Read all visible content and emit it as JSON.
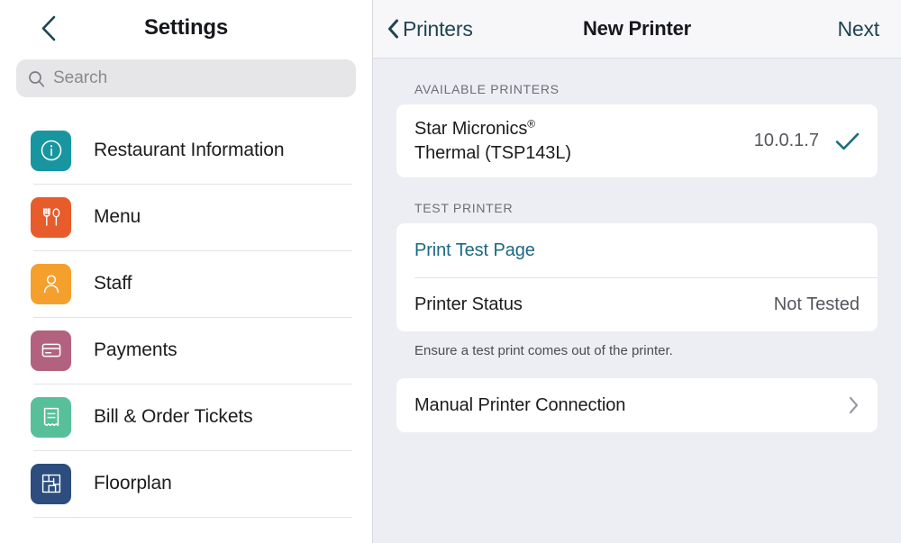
{
  "sidebar": {
    "back_icon": "chevron-left-icon",
    "title": "Settings",
    "search": {
      "icon": "search-icon",
      "value": "",
      "placeholder": "Search"
    },
    "items": [
      {
        "label": "Restaurant Information",
        "icon": "info-circle-icon",
        "color": "#1896a0"
      },
      {
        "label": "Menu",
        "icon": "fork-spoon-icon",
        "color": "#e85c2b"
      },
      {
        "label": "Staff",
        "icon": "person-icon",
        "color": "#f5a02c"
      },
      {
        "label": "Payments",
        "icon": "credit-card-icon",
        "color": "#b2627f"
      },
      {
        "label": "Bill & Order Tickets",
        "icon": "receipt-icon",
        "color": "#58bf9b"
      },
      {
        "label": "Floorplan",
        "icon": "blueprint-icon",
        "color": "#2c4d7e"
      }
    ]
  },
  "detail": {
    "back_label": "Printers",
    "back_icon": "chevron-left-icon",
    "title": "New Printer",
    "next_label": "Next",
    "highlight_color": "#ee0000",
    "accent_color": "#1b6a80",
    "available_section": {
      "label": "AVAILABLE PRINTERS",
      "printers": [
        {
          "name_line1": "Star Micronics",
          "name_superscript": "®",
          "name_line2": "Thermal (TSP143L)",
          "ip": "10.0.1.7",
          "selected_icon": "checkmark-icon"
        }
      ]
    },
    "test_section": {
      "label": "TEST PRINTER",
      "print_test_label": "Print Test Page",
      "status_label": "Printer Status",
      "status_value": "Not Tested",
      "footnote": "Ensure a test print comes out of the printer."
    },
    "manual_section": {
      "label": "Manual Printer Connection",
      "chevron_icon": "chevron-right-icon"
    }
  }
}
